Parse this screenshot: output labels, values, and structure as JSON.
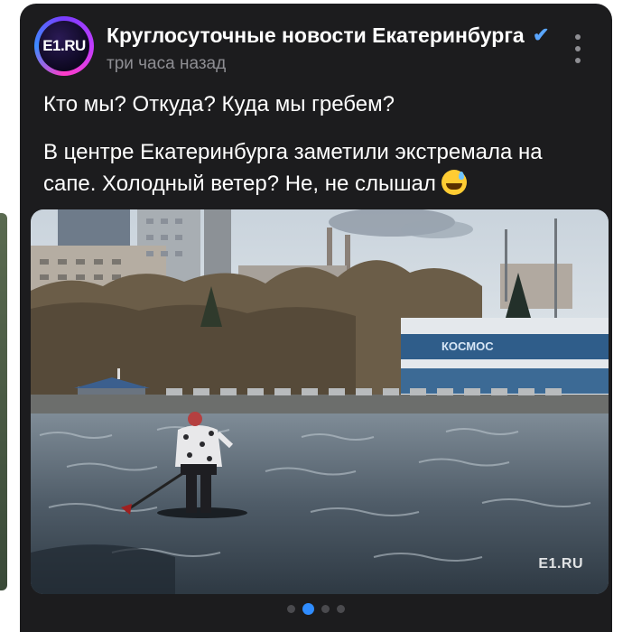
{
  "post": {
    "channel_name": "Круглосуточные новости Екатеринбурга",
    "avatar_text": "E1.RU",
    "timestamp": "три часа назад",
    "paragraphs": [
      "Кто мы? Откуда? Куда мы гребем?",
      "В центре Екатеринбурга заметили экстремала на сапе. Холодный ветер? Не, не слышал"
    ],
    "emoji": "sweat-smile-emoji",
    "photo_watermark": "E1.RU",
    "building_sign": "КОСМОС"
  },
  "carousel": {
    "total": 4,
    "active_index": 1
  },
  "colors": {
    "card_bg": "#1c1c1e",
    "verified": "#5aa6ff",
    "active_dot": "#2f8cff"
  }
}
